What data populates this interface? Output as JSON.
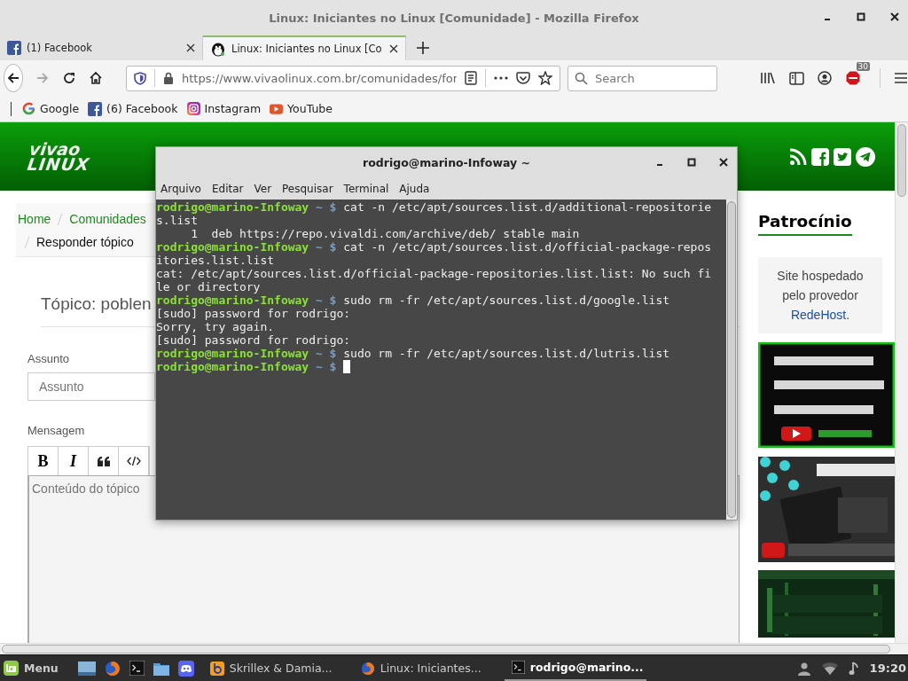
{
  "browser": {
    "title": "Linux: Iniciantes no Linux [Comunidade] - Mozilla Firefox",
    "tabs": [
      {
        "label": "(1) Facebook",
        "selected": false,
        "kind": "facebook"
      },
      {
        "label": "Linux: Iniciantes no Linux [Co",
        "selected": true,
        "kind": "penguin"
      }
    ],
    "url": "https://www.vivaolinux.com.br/comunidades/for",
    "search": {
      "placeholder": "Search"
    },
    "addon_badge": "30",
    "bookmarks": [
      {
        "label": "Google",
        "kind": "google"
      },
      {
        "label": "(6) Facebook",
        "kind": "facebook"
      },
      {
        "label": "Instagram",
        "kind": "instagram"
      },
      {
        "label": "YouTube",
        "kind": "youtube"
      }
    ]
  },
  "page": {
    "logo": {
      "line1": "vivao",
      "line2": "LINUX"
    },
    "breadcrumb": [
      {
        "label": "Home",
        "kind": "link"
      },
      {
        "label": "Comunidades",
        "kind": "link"
      },
      {
        "label": "Responder tópico",
        "kind": "current"
      }
    ],
    "topic_title": "Tópico: poblen",
    "subject": {
      "label": "Assunto",
      "placeholder": "Assunto"
    },
    "message": {
      "label": "Mensagem",
      "placeholder": "Conteúdo do tópico",
      "toolbar": [
        {
          "kind": "bold",
          "label": "B"
        },
        {
          "kind": "italic",
          "label": "I"
        },
        {
          "kind": "quote"
        },
        {
          "kind": "code"
        }
      ]
    },
    "sidebar": {
      "heading": "Patrocínio",
      "sponsor": {
        "text": "Site hospedado pelo provedor",
        "link": "RedeHost",
        "after": "."
      }
    }
  },
  "terminal": {
    "title": "rodrigo@marino-Infoway ~",
    "menu": [
      "Arquivo",
      "Editar",
      "Ver",
      "Pesquisar",
      "Terminal",
      "Ajuda"
    ],
    "lines": [
      {
        "kind": "prompt",
        "user": "rodrigo@marino-Infoway",
        "path": "~",
        "symbol": "$",
        "command": "cat -n /etc/apt/sources.list.d/additional-repositorie"
      },
      {
        "kind": "output",
        "text": "s.list"
      },
      {
        "kind": "output",
        "text": "     1  deb https://repo.vivaldi.com/archive/deb/ stable main"
      },
      {
        "kind": "prompt",
        "user": "rodrigo@marino-Infoway",
        "path": "~",
        "symbol": "$",
        "command": "cat -n /etc/apt/sources.list.d/official-package-repos"
      },
      {
        "kind": "output",
        "text": "itories.list.list"
      },
      {
        "kind": "output",
        "text": "cat: /etc/apt/sources.list.d/official-package-repositories.list.list: No such fi"
      },
      {
        "kind": "output",
        "text": "le or directory"
      },
      {
        "kind": "prompt",
        "user": "rodrigo@marino-Infoway",
        "path": "~",
        "symbol": "$",
        "command": "sudo rm -fr /etc/apt/sources.list.d/google.list"
      },
      {
        "kind": "output",
        "text": "[sudo] password for rodrigo:"
      },
      {
        "kind": "output",
        "text": "Sorry, try again."
      },
      {
        "kind": "output",
        "text": "[sudo] password for rodrigo:"
      },
      {
        "kind": "prompt",
        "user": "rodrigo@marino-Infoway",
        "path": "~",
        "symbol": "$",
        "command": "sudo rm -fr /etc/apt/sources.list.d/lutris.list"
      },
      {
        "kind": "prompt",
        "user": "rodrigo@marino-Infoway",
        "path": "~",
        "symbol": "$",
        "cursor": true
      }
    ]
  },
  "taskbar": {
    "menu_label": "Menu",
    "windows": [
      {
        "label": "Skrillex & Damia...",
        "kind": "player",
        "selected": false
      },
      {
        "label": "Linux: Iniciantes...",
        "kind": "browser",
        "selected": false
      },
      {
        "label": "rodrigo@marino...",
        "kind": "terminal",
        "selected": true
      }
    ],
    "clock": "19:20"
  }
}
